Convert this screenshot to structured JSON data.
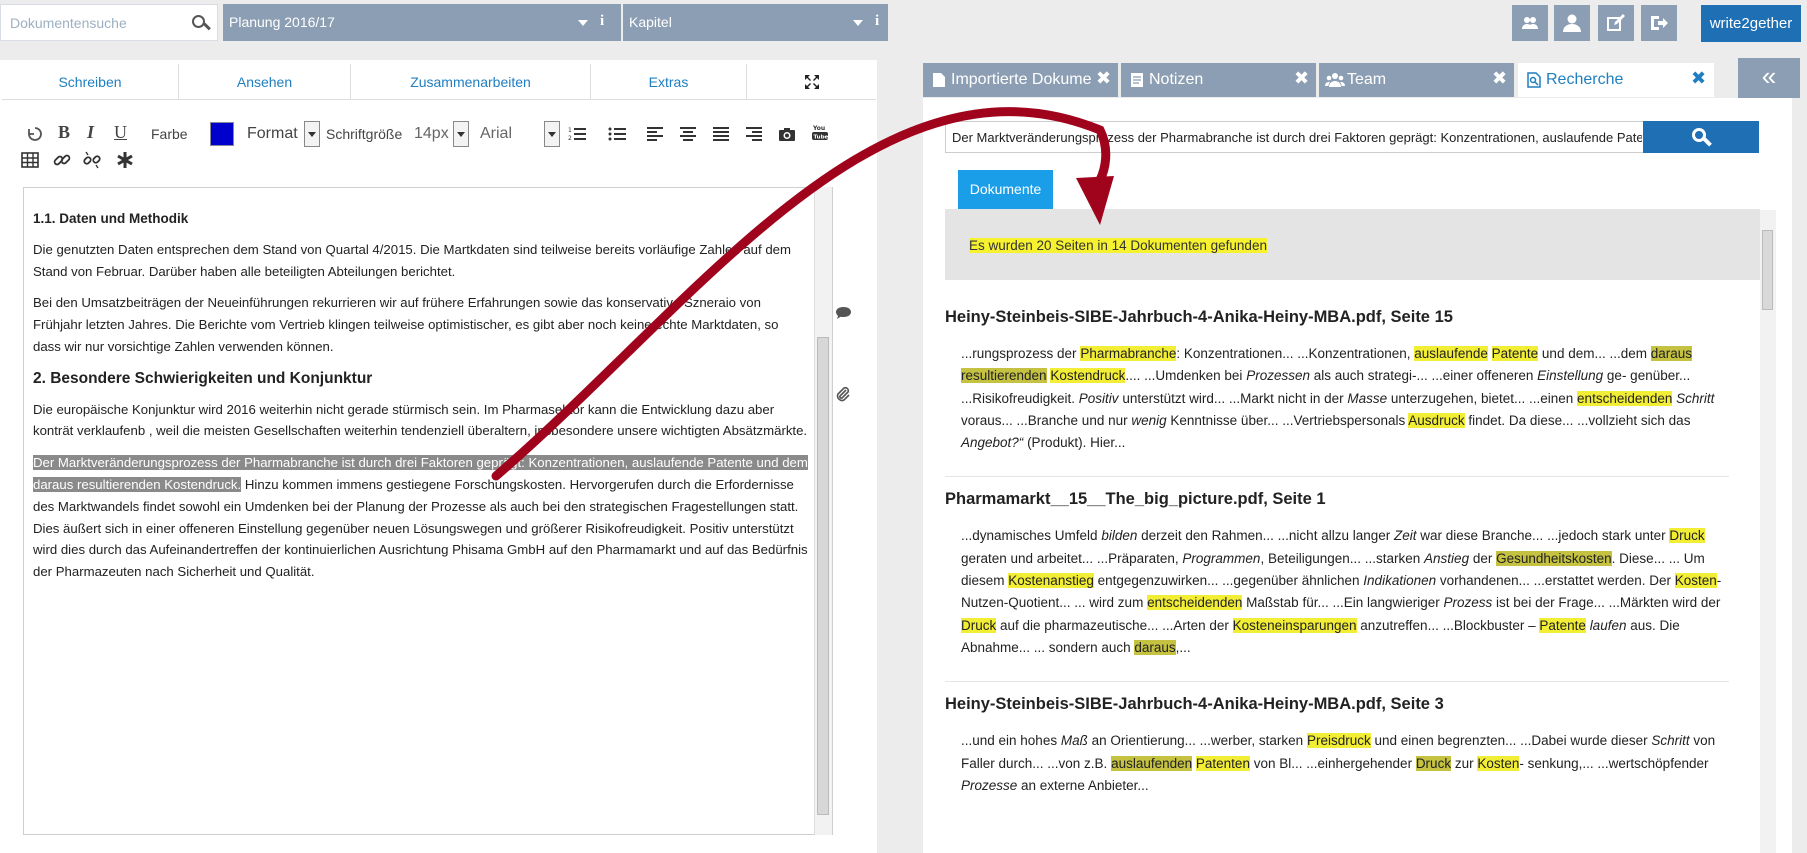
{
  "header": {
    "search_placeholder": "Dokumentensuche",
    "project_select": "Planung 2016/17",
    "chapter_select": "Kapitel",
    "info_glyph": "i",
    "brand_button": "write2gether"
  },
  "editor": {
    "tabs": [
      "Schreiben",
      "Ansehen",
      "Zusammenarbeiten",
      "Extras"
    ],
    "toolbar": {
      "bold": "B",
      "italic": "I",
      "underline": "U",
      "color_label": "Farbe",
      "color_value": "#0000cc",
      "format_label": "Format",
      "fontsize_label": "Schriftgröße",
      "fontsize_value": "14px",
      "font_value": "Arial"
    },
    "doc": {
      "h1": "1.1. Daten und Methodik",
      "p1": "Die genutzten Daten entsprechen dem Stand von Quartal 4/2015. Die Martkdaten sind teilweise bereits vorläufige Zahlen auf dem Stand von Februar. Darüber haben alle beteiligten Abteilungen berichtet.",
      "p2": "Bei den Umsatzbeiträgen der Neueinführungen rekurrieren wir auf frühere Erfahrungen sowie das konservative Szneraio von Frühjahr letzten Jahres. Die Berichte vom Vertrieb klingen teilweise optimistischer, es gibt aber noch keine echte Marktdaten, so dass wir nur vorsichtige Zahlen verwenden können.",
      "h2": "2. Besondere Schwierigkeiten und Konjunktur",
      "p3": "Die europäische Konjunktur wird 2016 weiterhin nicht gerade stürmisch sein. Im Pharmasektor kann die Entwicklung dazu aber konträt verklaufenb , weil die meisten Gesellschaften weiterhin tendenziell überaltern, insbesondere unsere wichtigten Absätzmärkte.",
      "p4_selected": "Der Marktveränderungsprozess der Pharmabranche ist durch drei Faktoren geprägt: Konzentrationen, auslaufende Patente und dem daraus resultierenden Kostendruck.",
      "p4_rest": " Hinzu kommen immens gestiegene Forschungskosten. Hervorgerufen durch die Erfordernisse des Marktwandels findet sowohl ein Umdenken bei der Planung der Prozesse als auch bei den strategischen Fragestellungen statt. Dies äußert sich in einer offeneren Einstellung gegenüber neuen Lösungswegen und größerer Risikofreudigkeit. Positiv unterstützt wird dies durch das Aufeinandertreffen der kontinuierlichen Ausrichtung Phisama GmbH auf den Pharmamarkt und auf das Bedürfnis der Pharmazeuten nach Sicherheit und Qualität."
    }
  },
  "right": {
    "tabs": [
      {
        "label": "Importierte Dokumente",
        "icon": "document-icon"
      },
      {
        "label": "Notizen",
        "icon": "notes-icon"
      },
      {
        "label": "Team",
        "icon": "team-icon"
      },
      {
        "label": "Recherche",
        "icon": "research-icon"
      }
    ],
    "close_glyph": "✖",
    "collapse_glyph": "«",
    "search_query": "Der Marktveränderungsprozess der Pharmabranche ist durch drei Faktoren geprägt: Konzentrationen, auslaufende Patente und dem daraus resultierenden Kostendruck.",
    "subtab": "Dokumente",
    "result_count": "Es wurden 20 Seiten in 14 Dokumenten gefunden",
    "results": [
      {
        "title": "Heiny-Steinbeis-SIBE-Jahrbuch-4-Anika-Heiny-MBA.pdf, Seite 15"
      },
      {
        "title": "Pharmamarkt__15__The_big_picture.pdf, Seite 1"
      },
      {
        "title": "Heiny-Steinbeis-SIBE-Jahrbuch-4-Anika-Heiny-MBA.pdf, Seite 3"
      }
    ]
  },
  "colors": {
    "accent": "#1f7fc0",
    "tab_bg": "#8c9eb3",
    "highlight_yellow": "#f2ee35",
    "highlight_olive": "#c5c241",
    "arrow": "#a0041c"
  }
}
